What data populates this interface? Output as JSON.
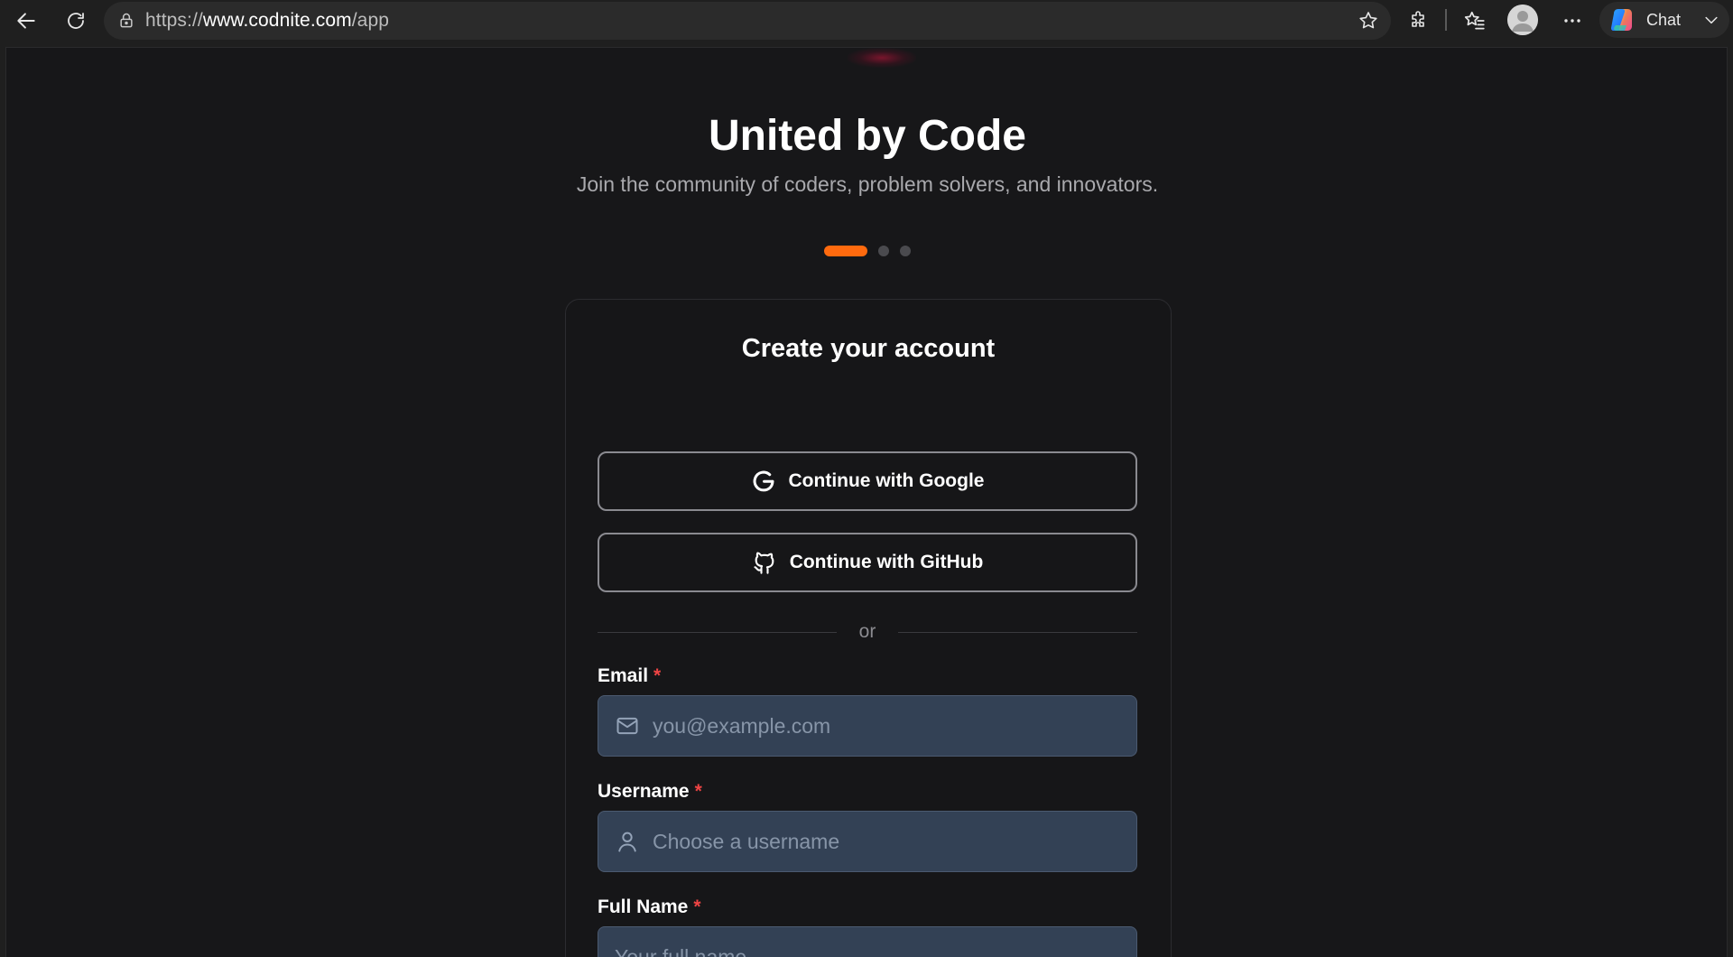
{
  "browser": {
    "url_scheme": "https://",
    "url_host": "www.codnite.com",
    "url_path": "/app",
    "chat_label": "Chat"
  },
  "hero": {
    "title": "United by Code",
    "subtitle": "Join the community of coders, problem solvers, and innovators.",
    "carousel_active_index": 0,
    "carousel_count": 3,
    "accent_color": "#ff6a0e"
  },
  "signup": {
    "title": "Create your account",
    "google_label": "Continue with Google",
    "github_label": "Continue with GitHub",
    "divider_text": "or",
    "required_marker": "*",
    "email": {
      "label": "Email",
      "placeholder": "you@example.com",
      "value": ""
    },
    "username": {
      "label": "Username",
      "placeholder": "Choose a username",
      "value": ""
    },
    "full_name": {
      "label": "Full Name",
      "placeholder": "Your full name",
      "value": ""
    }
  },
  "icons": {
    "back": "back-arrow-icon",
    "refresh": "refresh-icon",
    "lock": "lock-icon",
    "favorite": "star-icon",
    "extensions": "puzzle-icon",
    "favorites": "favorites-icon",
    "profile": "avatar",
    "more": "more-icon",
    "copilot": "copilot-icon",
    "google": "google-icon",
    "github": "github-icon",
    "mail": "mail-icon",
    "user": "user-icon"
  }
}
